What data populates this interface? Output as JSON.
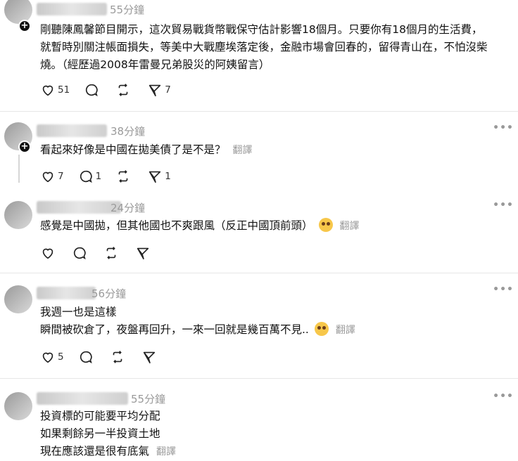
{
  "posts": [
    {
      "time": "55分鐘",
      "lines": [
        "剛聽陳鳳馨節目開示，這次貿易戰貨幣戰保守估計影響18個月。只要你有18個月的生活費，",
        "就暫時別關注帳面損失，等美中大戰塵埃落定後，金融市場會回春的，留得青山在，不怕沒柴",
        "燒。（經歷過2008年雷曼兄弟股災的阿姨留言）"
      ],
      "translate": "",
      "likes": "51",
      "replies": "",
      "reposts": "",
      "shares": "7"
    },
    {
      "time": "38分鐘",
      "lines": [
        "看起來好像是中國在拋美債了是不是？"
      ],
      "translate": "翻譯",
      "likes": "7",
      "replies": "1",
      "reposts": "",
      "shares": "1"
    },
    {
      "time": "24分鐘",
      "lines": [
        "感覺是中國拋，但其他國也不爽跟風（反正中國頂前頭）"
      ],
      "translate": "翻譯",
      "likes": "",
      "replies": "",
      "reposts": "",
      "shares": ""
    },
    {
      "time": "56分鐘",
      "lines": [
        "我週一也是這樣",
        "瞬間被砍倉了，夜盤再回升，一來一回就是幾百萬不見.."
      ],
      "translate": "翻譯",
      "likes": "5",
      "replies": "",
      "reposts": "",
      "shares": ""
    },
    {
      "time": "55分鐘",
      "lines": [
        "投資標的可能要平均分配",
        "如果剩餘另一半投資土地",
        "現在應該還是很有底氣"
      ],
      "translate": "翻譯"
    }
  ],
  "icons": {
    "like": "heart-icon",
    "reply": "comment-icon",
    "repost": "repost-icon",
    "share": "share-icon",
    "more": "more-icon",
    "follow": "plus-icon"
  }
}
